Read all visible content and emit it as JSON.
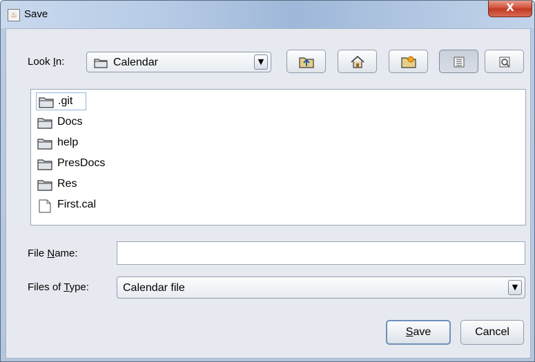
{
  "window": {
    "title": "Save",
    "close_label": "X"
  },
  "look_in": {
    "label_pre": "Look ",
    "label_mnemonic": "I",
    "label_post": "n:",
    "value": "Calendar"
  },
  "toolbar": {
    "buttons": [
      {
        "name": "up-one-level",
        "icon": "folder-up-icon"
      },
      {
        "name": "home",
        "icon": "home-icon"
      },
      {
        "name": "create-new-folder",
        "icon": "new-folder-icon"
      },
      {
        "name": "list-view",
        "icon": "list-view-icon",
        "pressed": true
      },
      {
        "name": "details-view",
        "icon": "details-view-icon"
      }
    ]
  },
  "files": [
    {
      "name": ".git",
      "type": "folder",
      "selected": true
    },
    {
      "name": "Docs",
      "type": "folder"
    },
    {
      "name": "help",
      "type": "folder"
    },
    {
      "name": "PresDocs",
      "type": "folder"
    },
    {
      "name": "Res",
      "type": "folder"
    },
    {
      "name": "First.cal",
      "type": "file"
    }
  ],
  "file_name": {
    "label_pre": "File ",
    "label_mnemonic": "N",
    "label_post": "ame:",
    "value": "",
    "placeholder": ""
  },
  "files_of_type": {
    "label_pre": "Files of ",
    "label_mnemonic": "T",
    "label_post": "ype:",
    "value": "Calendar file"
  },
  "buttons": {
    "save_mnemonic": "S",
    "save_rest": "ave",
    "cancel": "Cancel"
  },
  "colors": {
    "selection_border": "#8fb3d9",
    "close_red": "#c23b24",
    "folder_fill": "#dfe4ea"
  }
}
